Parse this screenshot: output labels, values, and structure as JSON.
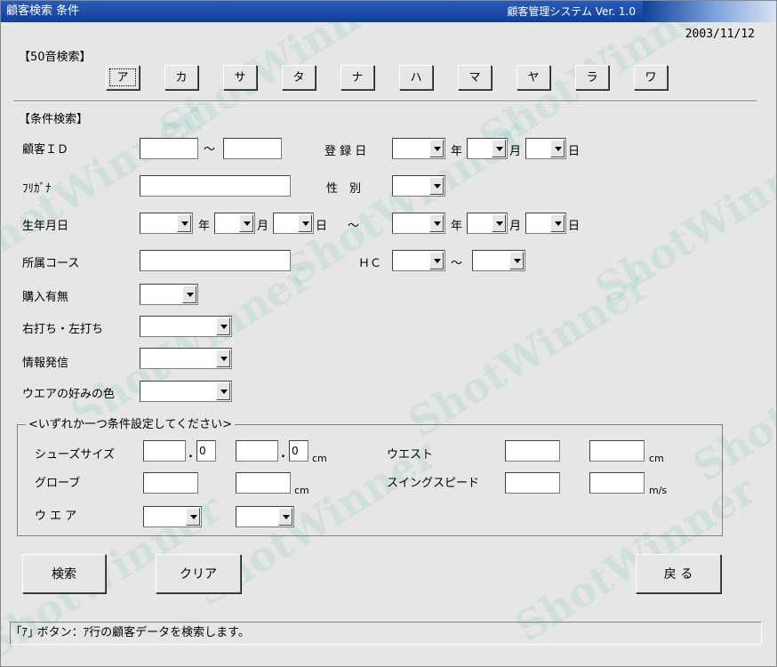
{
  "window": {
    "title": "顧客検索 条件",
    "app_version": "顧客管理システム Ver. 1.0",
    "date": "2003/11/12"
  },
  "watermark": "ShotWinner",
  "kana": {
    "label": "【50音検索】",
    "buttons": [
      "ア",
      "カ",
      "サ",
      "タ",
      "ナ",
      "ハ",
      "マ",
      "ヤ",
      "ラ",
      "ワ"
    ]
  },
  "cond": {
    "label": "【条件検索】",
    "customer_id": "顧客ＩＤ",
    "tilde": "～",
    "register_date": "登 録 日",
    "year": "年",
    "month": "月",
    "day": "日",
    "furigana": "ﾌﾘｶﾞﾅ",
    "gender": "性　別",
    "birth_date": "生年月日",
    "course": "所属コース",
    "hc": "ＨＣ",
    "purchase": "購入有無",
    "handed": "右打ち・左打ち",
    "info": "情報発信",
    "wear_color": "ウエアの好みの色"
  },
  "group": {
    "title": "<いずれか一つ条件設定してください>",
    "shoes_size": "シューズサイズ",
    "shoes_dec1": "0",
    "shoes_dec2": "0",
    "dot": ".",
    "glove": "グローブ",
    "wear": "ウ エ ア",
    "waist": "ウエスト",
    "swing_speed": "スイングスピード",
    "cm": "cm",
    "ms": "m/s"
  },
  "buttons": {
    "search": "検索",
    "clear": "クリア",
    "back": "戻 る"
  },
  "status": "｢ｱ｣ ボタン：ｱ行の顧客データを検索します。"
}
